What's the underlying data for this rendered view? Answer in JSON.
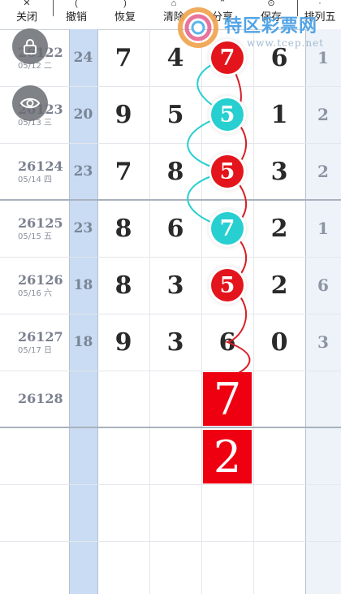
{
  "toolbar": {
    "items": [
      {
        "label": "关闭",
        "icon": "close-icon"
      },
      {
        "label": "撤销",
        "icon": "undo-icon"
      },
      {
        "label": "恢复",
        "icon": "redo-icon"
      },
      {
        "label": "清除",
        "icon": "clear-icon"
      },
      {
        "label": "分享",
        "icon": "share-icon"
      },
      {
        "label": "保存",
        "icon": "save-icon"
      },
      {
        "label": "排列五",
        "icon": "lottery-type-icon"
      }
    ]
  },
  "watermark": {
    "title": "特区彩票网",
    "url": "www.tcep.net"
  },
  "rows": [
    {
      "issue": "26122",
      "date": "05/12 二",
      "sum": "24",
      "digits": [
        "7",
        "4",
        "7",
        "6"
      ],
      "extra": "1"
    },
    {
      "issue": "26123",
      "date": "05/13 三",
      "sum": "20",
      "digits": [
        "9",
        "5",
        "5",
        "1"
      ],
      "extra": "2"
    },
    {
      "issue": "26124",
      "date": "05/14 四",
      "sum": "23",
      "digits": [
        "7",
        "8",
        "5",
        "3"
      ],
      "extra": "2"
    },
    {
      "issue": "26125",
      "date": "05/15 五",
      "sum": "23",
      "digits": [
        "8",
        "6",
        "7",
        "2"
      ],
      "extra": "1"
    },
    {
      "issue": "26126",
      "date": "05/16 六",
      "sum": "18",
      "digits": [
        "8",
        "3",
        "5",
        "2"
      ],
      "extra": "6"
    },
    {
      "issue": "26127",
      "date": "05/17 日",
      "sum": "18",
      "digits": [
        "9",
        "3",
        "6",
        "0"
      ],
      "extra": "3"
    },
    {
      "issue": "26128",
      "date": "",
      "sum": "",
      "digits": [
        "",
        "",
        "",
        ""
      ],
      "extra": ""
    }
  ],
  "marked_balls": [
    {
      "row": 0,
      "value": "7",
      "color": "red"
    },
    {
      "row": 1,
      "value": "5",
      "color": "cyan"
    },
    {
      "row": 2,
      "value": "5",
      "color": "red"
    },
    {
      "row": 3,
      "value": "7",
      "color": "cyan"
    },
    {
      "row": 4,
      "value": "5",
      "color": "red"
    }
  ],
  "predictions": [
    "7",
    "2"
  ],
  "colors": {
    "red": "#e3141b",
    "cyan": "#27cfd0",
    "sum_column_bg": "#c9dcf4",
    "prediction_bg": "#ee0011"
  }
}
